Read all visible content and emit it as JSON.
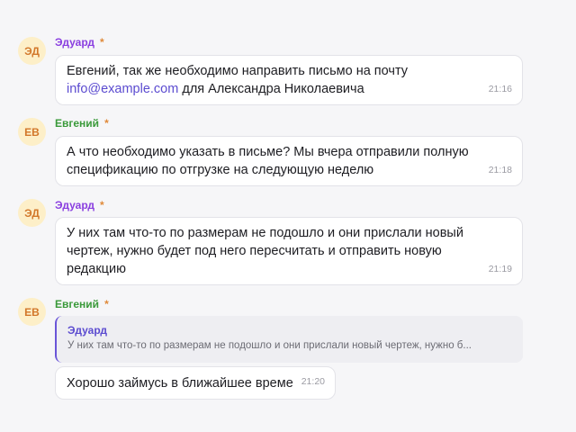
{
  "messages": [
    {
      "initials": "ЭД",
      "author": "Эдуард",
      "star": "*",
      "color": "#8a3fe0",
      "line1": "Евгений, так же необходимо направить письмо на почту",
      "link": "info@example.com",
      "line2": " для Александра Николаевича",
      "time": "21:16"
    },
    {
      "initials": "ЕВ",
      "author": "Евгений",
      "star": "*",
      "color": "#3a9a3a",
      "line1": "А что необходимо указать в письме? Мы вчера отправили полную",
      "line2": "спецификацию по отгрузке на следующую неделю",
      "time": "21:18"
    },
    {
      "initials": "ЭД",
      "author": "Эдуард",
      "star": "*",
      "color": "#8a3fe0",
      "line1": "У них там что-то по размерам не подошло и они прислали новый",
      "line2": "чертеж, нужно будет под него пересчитать и отправить новую",
      "line3": "редакцию",
      "time": "21:19"
    },
    {
      "initials": "ЕВ",
      "author": "Евгений",
      "star": "*",
      "color": "#3a9a3a",
      "quote_author": "Эдуард",
      "quote_text": "У них там что-то по размерам не подошло и они прислали новый чертеж, нужно б...",
      "text": "Хорошо займусь в ближайшее време",
      "time": "21:20"
    }
  ]
}
